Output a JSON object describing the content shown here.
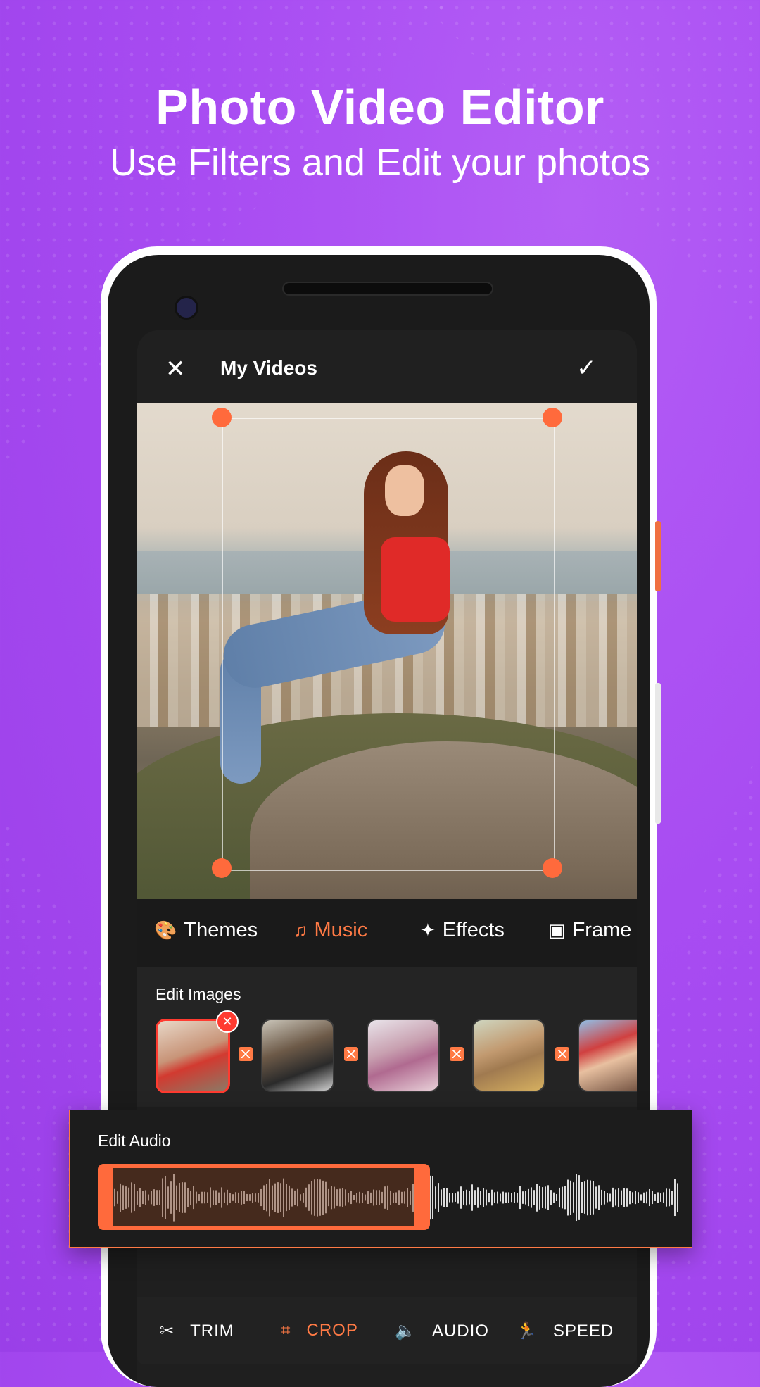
{
  "promo": {
    "headline": "Photo Video Editor",
    "subline": "Use Filters and Edit your photos"
  },
  "app": {
    "title": "My Videos",
    "close_icon": "close-icon",
    "confirm_icon": "check-icon"
  },
  "tabs": [
    {
      "label": "Themes",
      "icon": "palette-icon",
      "active": false
    },
    {
      "label": "Music",
      "icon": "music-note-icon",
      "active": true
    },
    {
      "label": "Effects",
      "icon": "magic-wand-icon",
      "active": false
    },
    {
      "label": "Frame",
      "icon": "frame-icon",
      "active": false
    }
  ],
  "edit_images": {
    "label": "Edit Images",
    "thumbnails": 5
  },
  "edit_audio": {
    "label": "Edit Audio"
  },
  "toolbar": [
    {
      "label": "TRIM",
      "icon": "scissors-icon",
      "active": false
    },
    {
      "label": "CROP",
      "icon": "crop-icon",
      "active": true
    },
    {
      "label": "AUDIO",
      "icon": "volume-icon",
      "active": false
    },
    {
      "label": "SPEED",
      "icon": "running-icon",
      "active": false
    }
  ],
  "colors": {
    "accent": "#ff7a45",
    "background": "#a84cf2",
    "remove_badge": "#ff3b30"
  }
}
